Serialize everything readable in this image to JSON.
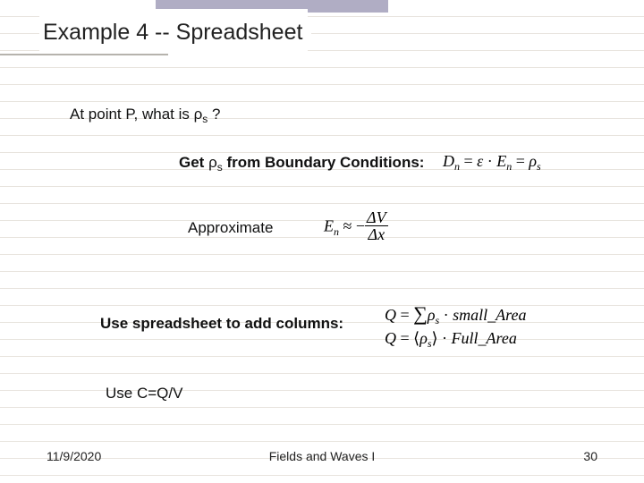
{
  "title": "Example 4 -- Spreadsheet",
  "line1": {
    "pre": "At point P, what is ",
    "rho": "ρ",
    "sub": "s",
    "post": " ?"
  },
  "line2": {
    "pre": "Get ",
    "rho": "ρ",
    "sub": "s",
    "post": " from Boundary Conditions:"
  },
  "line3": "Approximate",
  "line4": "Use spreadsheet to add columns:",
  "line5": "Use C=Q/V",
  "eq_bc": {
    "D": "D",
    "Dn": "n",
    "eq1": " = ",
    "eps": "ε",
    "dot1": " · ",
    "E": "E",
    "En": "n",
    "eq2": " = ",
    "rho": "ρ",
    "rs": "s"
  },
  "eq_approx": {
    "E": "E",
    "En": "n",
    "approx": " ≈ ",
    "minus": "−",
    "dV": "ΔV",
    "dx": "Δx"
  },
  "eq_q1": {
    "Q": "Q",
    "eq": " = ",
    "sum": "∑",
    "rho": "ρ",
    "rs": "s",
    "dot": " · ",
    "small": "small",
    "und": "_",
    "area": "Area"
  },
  "eq_q2": {
    "Q": "Q",
    "eq": " = ",
    "lb": "⟨",
    "rho": "ρ",
    "rs": "s",
    "rb": "⟩",
    "dot": " · ",
    "full": "Full",
    "und": "_",
    "area": "Area"
  },
  "footer": {
    "date": "11/9/2020",
    "course": "Fields and Waves I",
    "page": "30"
  }
}
